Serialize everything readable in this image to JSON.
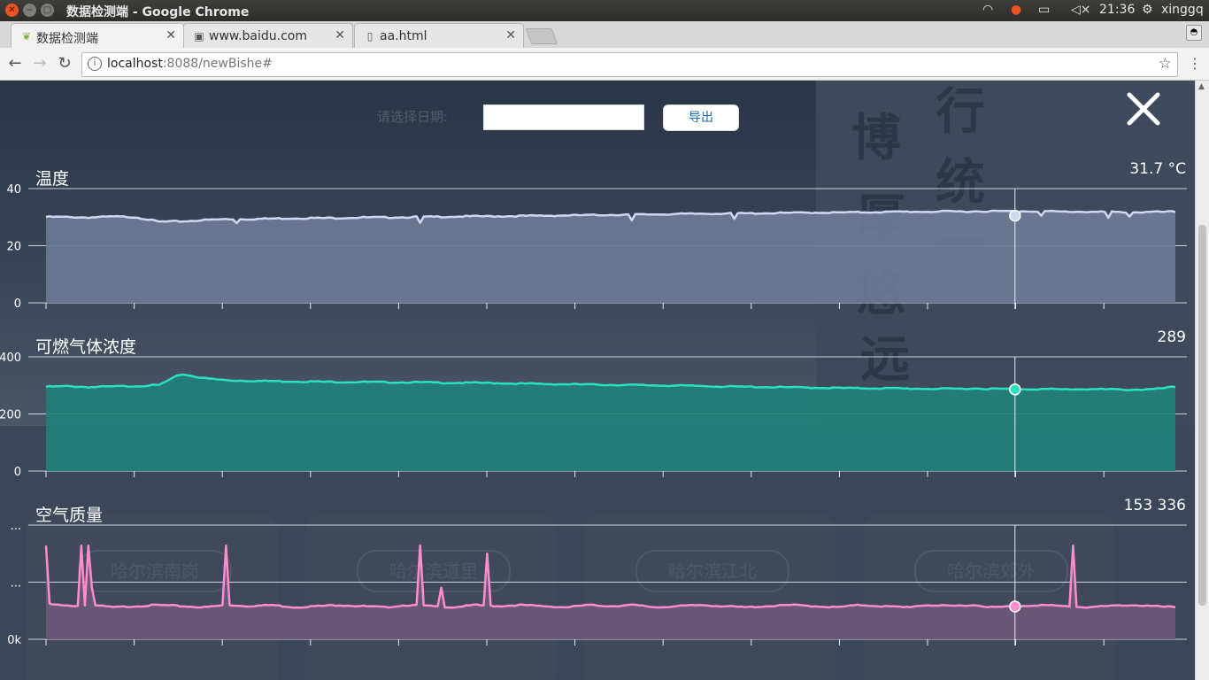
{
  "window": {
    "title": "数据检测端 - Google Chrome",
    "clock": "21:36",
    "user": "xinggq"
  },
  "tabs": [
    {
      "label": "数据检测端",
      "icon": "leaf-icon"
    },
    {
      "label": "www.baidu.com",
      "icon": "paw-icon"
    },
    {
      "label": "aa.html",
      "icon": "page-icon"
    }
  ],
  "address": {
    "host": "localhost",
    "rest": ":8088/newBishe#"
  },
  "page": {
    "date_label": "请选择日期:",
    "date_value": "",
    "export_label": "导出",
    "background_calligraphy": [
      "行",
      "统",
      "一",
      "博",
      "厚",
      "悠",
      "远"
    ],
    "background_cards": [
      "哈尔滨南岗",
      "哈尔滨道里",
      "哈尔滨江北",
      "哈尔滨郊外"
    ]
  },
  "chart_data": [
    {
      "type": "area",
      "title": "温度",
      "current_value": "31.7 °C",
      "ytick_labels": [
        "40",
        "20",
        "0"
      ],
      "ylim": [
        0,
        40
      ],
      "color": "#cdd8f2",
      "fill": "#6b7a95",
      "points": [
        30.1,
        30.0,
        29.9,
        30.2,
        30.0,
        28.4,
        28.5,
        29.0,
        29.3,
        29.3,
        29.5,
        29.6,
        29.7,
        29.7,
        29.9,
        29.9,
        30.0,
        30.1,
        30.2,
        30.3,
        30.3,
        30.4,
        30.5,
        30.6,
        30.7,
        30.8,
        30.9,
        31.0,
        31.1,
        31.2,
        31.3,
        31.3,
        31.4,
        31.5,
        31.6,
        31.6,
        31.7,
        31.8,
        31.9,
        31.9,
        32.0,
        32.0,
        32.1,
        32.1,
        32.1,
        31.9,
        31.9,
        31.8,
        31.7,
        31.8,
        31.9
      ],
      "dips": [
        [
          0.17,
          27.9
        ],
        [
          0.33,
          28.0
        ],
        [
          0.52,
          28.9
        ],
        [
          0.61,
          29.4
        ],
        [
          0.86,
          30.5
        ],
        [
          0.88,
          30.5
        ],
        [
          0.94,
          29.8
        ],
        [
          0.96,
          30.2
        ]
      ],
      "highlight_x": 0.858
    },
    {
      "type": "area",
      "title": "可燃气体浓度",
      "current_value": "289",
      "ytick_labels": [
        "400",
        "200",
        "0"
      ],
      "ylim": [
        0,
        400
      ],
      "color": "#2be0c0",
      "fill": "#22807a",
      "points": [
        295,
        297,
        294,
        296,
        298,
        301,
        340,
        325,
        318,
        316,
        315,
        314,
        313,
        312,
        312,
        311,
        311,
        310,
        309,
        309,
        308,
        306,
        305,
        304,
        303,
        302,
        301,
        300,
        299,
        298,
        296,
        295,
        294,
        293,
        292,
        291,
        290,
        290,
        289,
        288,
        288,
        289,
        288,
        287,
        287,
        286,
        287,
        286,
        285,
        286,
        295
      ],
      "dips": [],
      "highlight_x": 0.858
    },
    {
      "type": "area",
      "title": "空气质量",
      "current_value": "153 336",
      "ytick_labels": [
        "...",
        "...",
        "0k"
      ],
      "ylim": [
        0,
        1
      ],
      "color": "#ff8ccc",
      "fill": "#6b5878",
      "points": [
        0.31,
        0.29,
        0.3,
        0.28,
        0.29,
        0.3,
        0.29,
        0.28,
        0.3,
        0.29,
        0.3,
        0.28,
        0.29,
        0.3,
        0.29,
        0.28,
        0.3,
        0.29,
        0.28,
        0.3,
        0.29,
        0.3,
        0.29,
        0.28,
        0.3,
        0.29,
        0.3,
        0.28,
        0.29,
        0.3,
        0.29,
        0.28,
        0.29,
        0.3,
        0.29,
        0.28,
        0.3,
        0.29,
        0.28,
        0.3,
        0.29,
        0.3,
        0.28,
        0.29,
        0.3,
        0.29,
        0.28,
        0.29,
        0.3,
        0.29,
        0.28
      ],
      "spikes": [
        [
          0.0,
          0.82
        ],
        [
          0.03,
          0.82
        ],
        [
          0.037,
          0.82
        ],
        [
          0.04,
          0.45
        ],
        [
          0.16,
          0.82
        ],
        [
          0.33,
          0.82
        ],
        [
          0.35,
          0.45
        ],
        [
          0.39,
          0.75
        ],
        [
          0.91,
          0.82
        ]
      ],
      "highlight_x": 0.858
    }
  ]
}
